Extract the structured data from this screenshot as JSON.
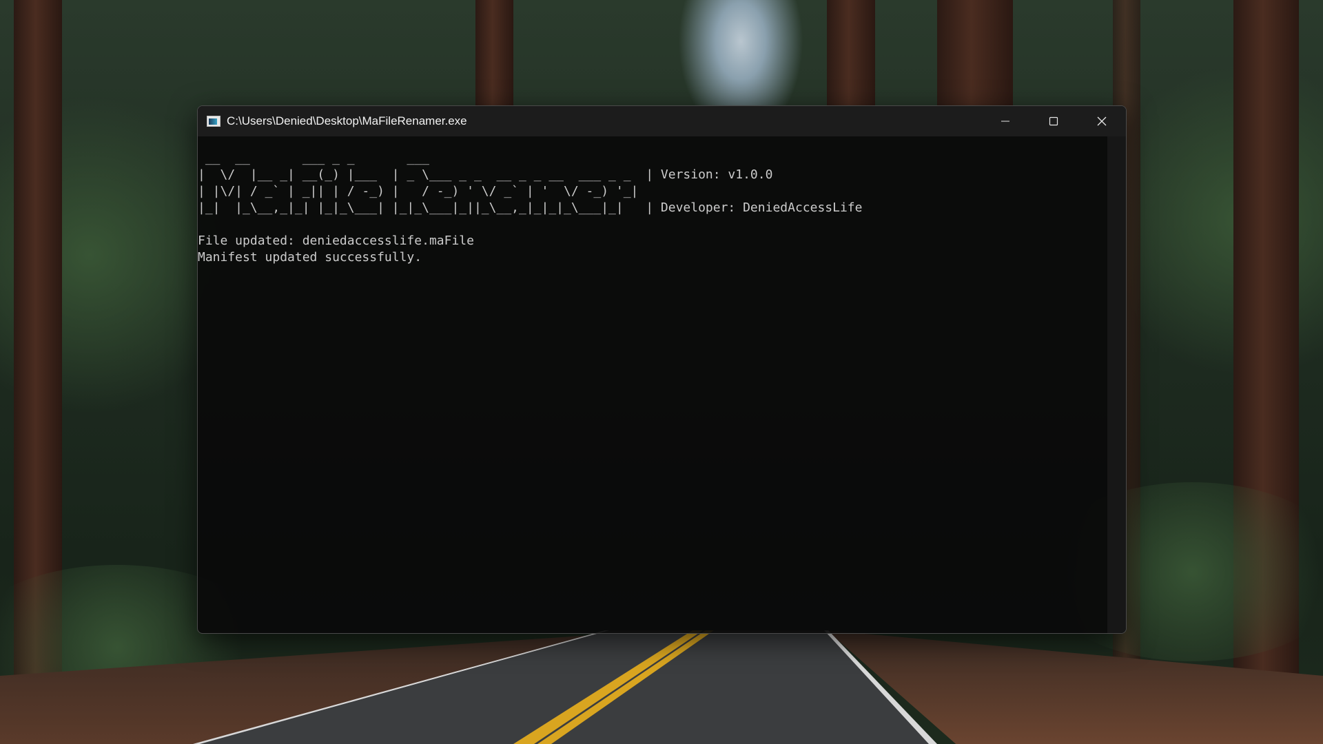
{
  "window": {
    "title": "C:\\Users\\Denied\\Desktop\\MaFileRenamer.exe",
    "icon": "console-app-icon"
  },
  "controls": {
    "minimize_icon": "minimize-icon",
    "maximize_icon": "maximize-icon",
    "close_icon": "close-icon"
  },
  "console": {
    "lines": [
      " __  __       ___ _ _       ___                                ",
      "|  \\/  |__ _| __(_) |___  | _ \\___ _ _  __ _ _ __  ___ _ _  | Version: v1.0.0",
      "| |\\/| / _` | _|| | / -_) |   / -_) ' \\/ _` | '  \\/ -_) '_|",
      "|_|  |_\\__,_|_| |_|_\\___| |_|_\\___|_||_\\__,_|_|_|_\\___|_|   | Developer: DeniedAccessLife",
      "",
      "File updated: deniedaccesslife.maFile",
      "Manifest updated successfully."
    ]
  },
  "colors": {
    "console_text": "#cccccc",
    "console_bg": "#0a0a0a",
    "titlebar_bg": "#1c1c1c"
  }
}
